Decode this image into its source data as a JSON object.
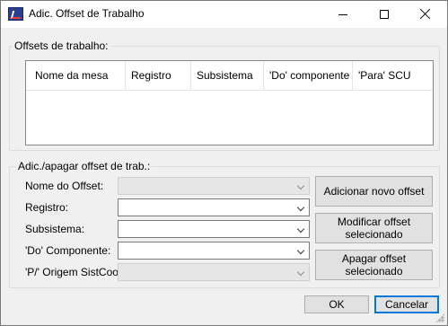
{
  "window": {
    "title": "Adic. Offset de Trabalho"
  },
  "offsets_group": {
    "legend": "Offsets de trabalho:",
    "columns": [
      "Nome da mesa",
      "Registro",
      "Subsistema",
      "'Do' componente",
      "'Para' SCU"
    ]
  },
  "edit_group": {
    "legend": "Adic./apagar offset de trab.:",
    "fields": [
      {
        "label": "Nome do Offset:",
        "value": "",
        "enabled": false
      },
      {
        "label": "Registro:",
        "value": "",
        "enabled": true
      },
      {
        "label": "Subsistema:",
        "value": "",
        "enabled": true
      },
      {
        "label": "'Do' Componente:",
        "value": "",
        "enabled": true
      },
      {
        "label": "'P/' Origem SistCoord",
        "value": "",
        "enabled": false
      }
    ],
    "buttons": {
      "add": "Adicionar novo offset",
      "modify": "Modificar offset selecionado",
      "delete": "Apagar offset selecionado"
    }
  },
  "footer": {
    "ok": "OK",
    "cancel": "Cancelar"
  }
}
